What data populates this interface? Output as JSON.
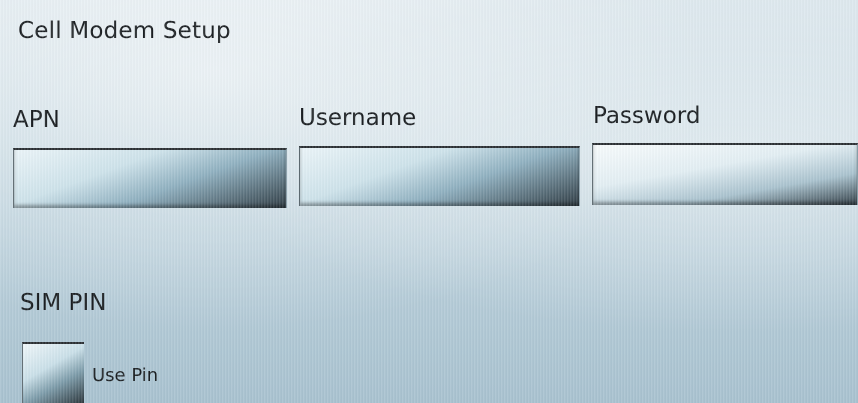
{
  "window": {
    "title": "Cell Modem Setup"
  },
  "fields": {
    "apn": {
      "label": "APN",
      "value": ""
    },
    "username": {
      "label": "Username",
      "value": ""
    },
    "password": {
      "label": "Password",
      "value": ""
    }
  },
  "sim_pin": {
    "section_label": "SIM PIN",
    "use_pin_label": "Use Pin",
    "use_pin_checked": false
  }
}
